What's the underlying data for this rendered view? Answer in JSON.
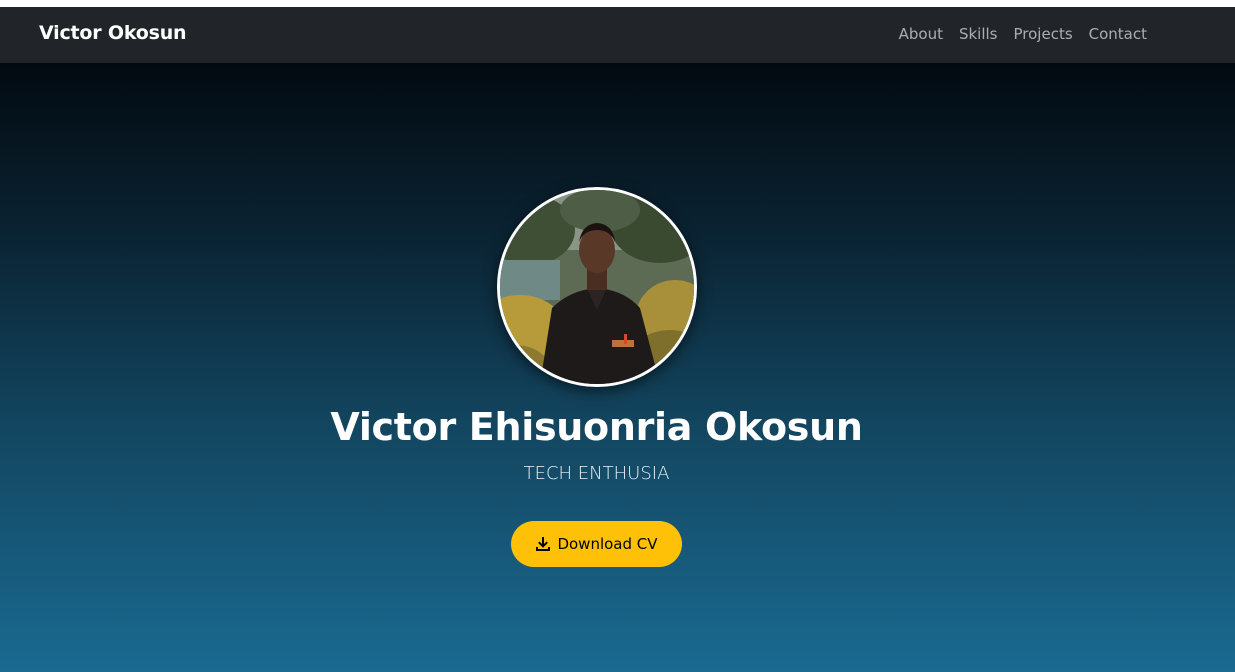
{
  "navbar": {
    "brand": "Victor Okosun",
    "links": [
      "About",
      "Skills",
      "Projects",
      "Contact"
    ]
  },
  "hero": {
    "name": "Victor Ehisuonria Okosun",
    "subtitle": "TECH ENTHUSIA",
    "cv_button_label": "Download CV",
    "cv_button_icon": "download-icon",
    "avatar": "profile-photo"
  },
  "colors": {
    "navbar_bg": "#212529",
    "button_bg": "#ffc107",
    "hero_top": "#020a10",
    "hero_bottom": "#1a6a91"
  }
}
